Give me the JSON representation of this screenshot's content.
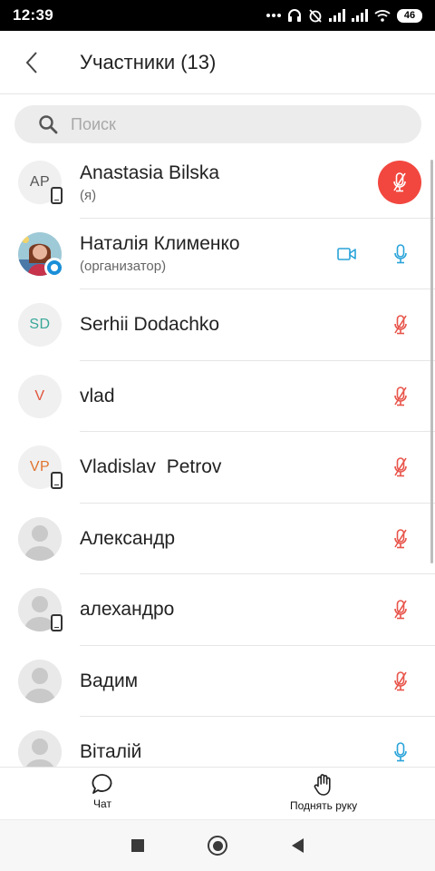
{
  "status_bar": {
    "time": "12:39",
    "battery": "46"
  },
  "header": {
    "title": "Участники (13)"
  },
  "search": {
    "placeholder": "Поиск"
  },
  "participants": [
    {
      "initials": "AP",
      "initials_color": "#555555",
      "name": "Anastasia Bilska",
      "sub": "(я)",
      "phone": true,
      "mic": "muted-active",
      "video": false
    },
    {
      "initials": "",
      "name": "Наталія Клименко",
      "sub": "(организатор)",
      "photo": true,
      "mic": "on",
      "video": true
    },
    {
      "initials": "SD",
      "initials_color": "#3aa89a",
      "name": "Serhii Dodachko",
      "sub": "",
      "mic": "muted",
      "video": false
    },
    {
      "initials": "V",
      "initials_color": "#e0533b",
      "name": "vlad",
      "sub": "",
      "mic": "muted",
      "video": false
    },
    {
      "initials": "VP",
      "initials_color": "#e0742e",
      "name": "Vladislav  Petrov",
      "sub": "",
      "phone": true,
      "mic": "muted",
      "video": false
    },
    {
      "initials": "",
      "name": "Александр",
      "sub": "",
      "person": true,
      "mic": "muted",
      "video": false
    },
    {
      "initials": "",
      "name": "алехандро",
      "sub": "",
      "person": true,
      "phone": true,
      "mic": "muted",
      "video": false
    },
    {
      "initials": "",
      "name": "Вадим",
      "sub": "",
      "person": true,
      "mic": "muted",
      "video": false
    },
    {
      "initials": "",
      "name": "Віталій",
      "sub": "",
      "person": true,
      "mic": "on",
      "video": false
    }
  ],
  "bottom_bar": {
    "chat_label": "Чат",
    "raise_hand_label": "Поднять руку"
  },
  "colors": {
    "mic_on": "#29a3d9",
    "mic_muted": "#e8544a",
    "red_button": "#f2473f"
  }
}
